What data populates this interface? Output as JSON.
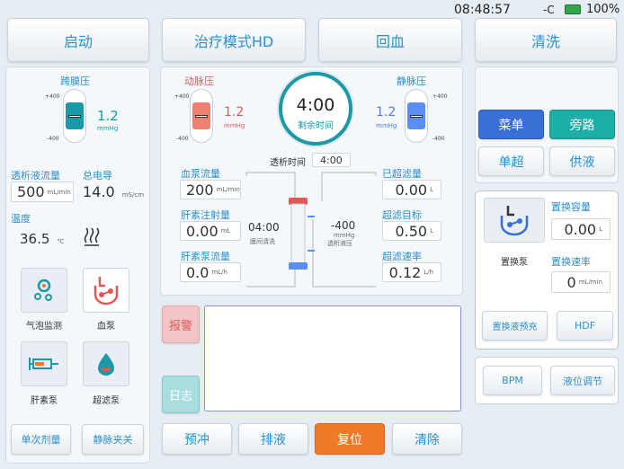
{
  "status_bar": {
    "time": "08:48:57",
    "battery": "100%"
  },
  "top_buttons": {
    "start": "启动",
    "mode": "治疗模式HD",
    "return_blood": "回血",
    "wash": "清洗"
  },
  "left": {
    "tmp_label": "跨膜压",
    "tmp_value": "1.2",
    "tmp_unit": "mmHg",
    "tmp_max": "+400",
    "tmp_min": "-400",
    "dialysate_flow_label": "透析液流量",
    "dialysate_flow_value": "500",
    "dialysate_flow_unit": "mL/min",
    "conductivity_label": "总电导",
    "conductivity_value": "14.0",
    "conductivity_unit": "mS/cm",
    "temp_label": "温度",
    "temp_value": "36.5",
    "temp_unit": "℃",
    "tiles": {
      "bubble": "气泡监测",
      "blood_pump": "血泵",
      "heparin_pump": "肝素泵",
      "uf_pump": "超滤泵"
    },
    "single_dose": "单次剂量",
    "venous_clamp": "静脉夹关"
  },
  "center": {
    "arterial_label": "动脉压",
    "arterial_value": "1.2",
    "arterial_unit": "mmHg",
    "venous_label": "静脉压",
    "venous_value": "1.2",
    "venous_unit": "mmHg",
    "gauge_max": "+400",
    "gauge_min": "-400",
    "remaining_time": "4:00",
    "remaining_label": "剩余时间",
    "dialysis_time_label": "透析时间",
    "dialysis_time_value": "4:00",
    "blood_flow_label": "血泵流量",
    "blood_flow_value": "200",
    "blood_flow_unit": "mL/min",
    "heparin_inj_label": "肝素注射量",
    "heparin_inj_value": "0.00",
    "heparin_inj_unit": "mL",
    "heparin_flow_label": "肝素泵流量",
    "heparin_flow_value": "0.0",
    "heparin_flow_unit": "mL/h",
    "interval_value": "04:00",
    "interval_label": "膜间清洗",
    "dialysate_pressure_value": "-400",
    "dialysate_pressure_unit": "mmHg",
    "dialysate_pressure_label": "透析液压",
    "uf_done_label": "已超滤量",
    "uf_done_value": "0.00",
    "uf_done_unit": "L",
    "uf_target_label": "超滤目标",
    "uf_target_value": "0.50",
    "uf_target_unit": "L",
    "uf_rate_label": "超滤速率",
    "uf_rate_value": "0.12",
    "uf_rate_unit": "L/h"
  },
  "alarm": {
    "alarm_btn": "报警",
    "log_btn": "日志"
  },
  "bottom": {
    "prime": "预冲",
    "drain": "排液",
    "reset": "复位",
    "clear": "清除"
  },
  "right": {
    "menu": "菜单",
    "bypass": "旁路",
    "single_uf": "单超",
    "supply": "供液",
    "sub_pump_label": "置换泵",
    "sub_volume_label": "置换容量",
    "sub_volume_value": "0.00",
    "sub_volume_unit": "L",
    "sub_rate_label": "置换速率",
    "sub_rate_value": "0",
    "sub_rate_unit": "mL/min",
    "sub_prime": "置换液预充",
    "hdf": "HDF",
    "bpm": "BPM",
    "level_adjust": "液位调节"
  },
  "colors": {
    "accent": "#2a8fd0",
    "arterial": "#e35757",
    "venous": "#4d7fe8",
    "tmp": "#1a9aa8",
    "reset": "#f07a2a",
    "menu": "#3a6fd6",
    "bypass": "#1ab0a8"
  }
}
